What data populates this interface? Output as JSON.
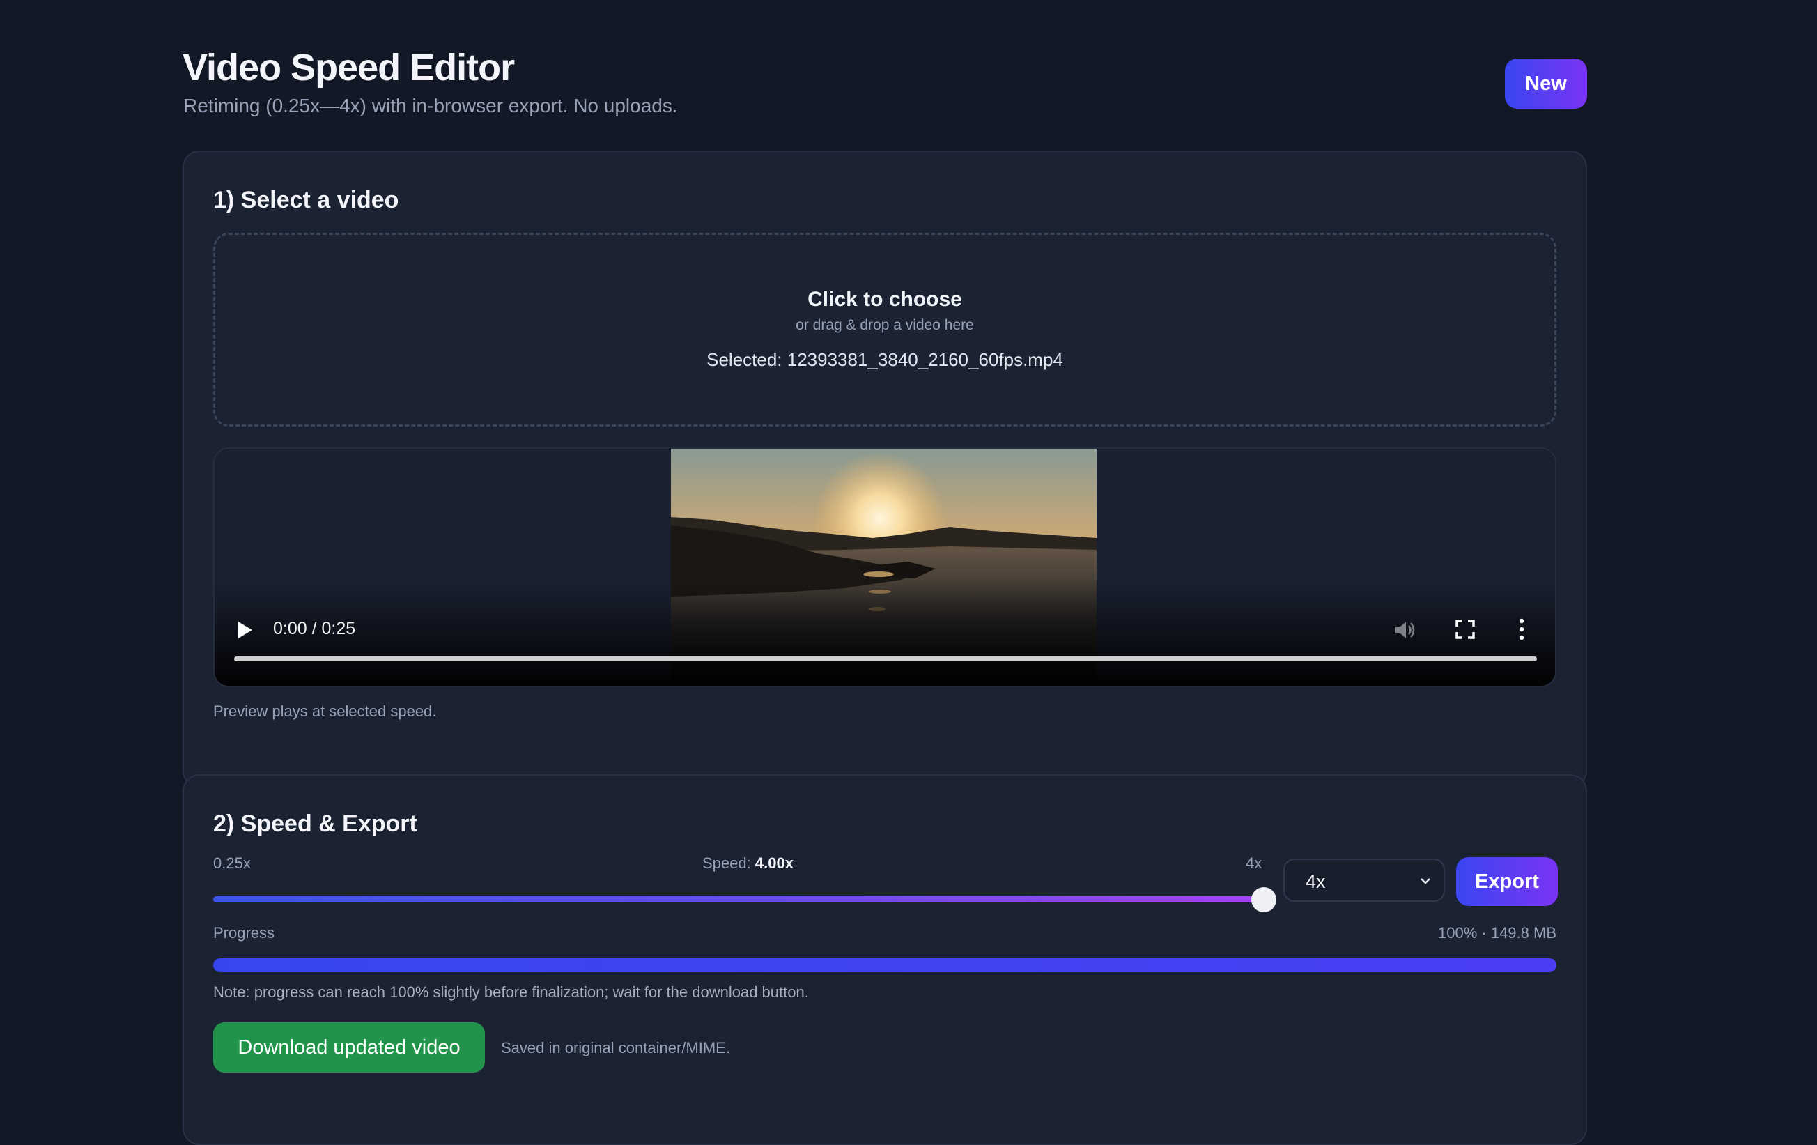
{
  "header": {
    "title": "Video Speed Editor",
    "subtitle": "Retiming (0.25x—4x) with in-browser export. No uploads.",
    "new_label": "New"
  },
  "select_section": {
    "title": "1) Select a video",
    "dropzone": {
      "main": "Click to choose",
      "sub": "or drag & drop a video here",
      "selected": "Selected: 12393381_3840_2160_60fps.mp4"
    },
    "player": {
      "time": "0:00 / 0:25",
      "icons": [
        "play-icon",
        "mute-icon",
        "fullscreen-icon",
        "more-options-icon"
      ]
    },
    "preview_note": "Preview plays at selected speed."
  },
  "speed_section": {
    "title": "2) Speed & Export",
    "min_label": "0.25x",
    "max_label": "4x",
    "speed_prefix": "Speed:",
    "speed_value": "4.00x",
    "slider": {
      "min": 0.25,
      "max": 4,
      "value": 4
    },
    "select_value": "4x",
    "export_label": "Export",
    "progress": {
      "label": "Progress",
      "info": "100% · 149.8 MB",
      "percent": 100,
      "note": "Note: progress can reach 100% slightly before finalization; wait for the download button."
    },
    "download_label": "Download updated video",
    "saved_note": "Saved in original container/MIME."
  },
  "colors": {
    "background": "#121826",
    "card": "#1b2231",
    "accent_start": "#3a46f2",
    "accent_end": "#7a34f3",
    "download": "#22934a"
  }
}
